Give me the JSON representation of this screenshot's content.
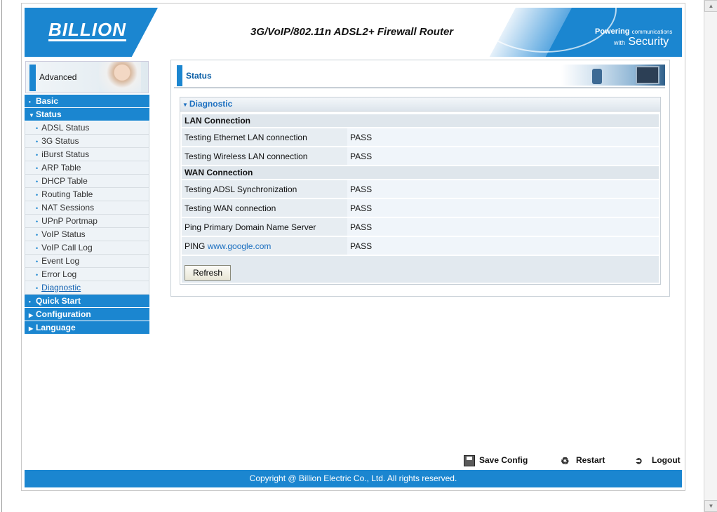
{
  "header": {
    "logo": "BILLION",
    "title": "3G/VoIP/802.11n ADSL2+ Firewall Router",
    "tagline_line1_bold": "Powering",
    "tagline_line1_small": "communications",
    "tagline_line2_small": "with",
    "tagline_line2_big": "Security"
  },
  "sidebar": {
    "mode_label": "Advanced",
    "sections": [
      {
        "label": "Basic",
        "expanded": false
      },
      {
        "label": "Status",
        "expanded": true
      }
    ],
    "status_items": [
      {
        "label": "ADSL Status"
      },
      {
        "label": "3G Status"
      },
      {
        "label": "iBurst Status"
      },
      {
        "label": "ARP Table"
      },
      {
        "label": "DHCP Table"
      },
      {
        "label": "Routing Table"
      },
      {
        "label": "NAT Sessions"
      },
      {
        "label": "UPnP Portmap"
      },
      {
        "label": "VoIP Status"
      },
      {
        "label": "VoIP Call Log"
      },
      {
        "label": "Event Log"
      },
      {
        "label": "Error Log"
      },
      {
        "label": "Diagnostic"
      }
    ],
    "bottom_sections": [
      {
        "label": "Quick Start"
      },
      {
        "label": "Configuration"
      },
      {
        "label": "Language"
      }
    ]
  },
  "main": {
    "title": "Status",
    "diagnostic": {
      "heading": "Diagnostic",
      "lan_section": "LAN Connection",
      "lan_rows": [
        {
          "label": "Testing Ethernet LAN connection",
          "result": "PASS"
        },
        {
          "label": "Testing Wireless LAN connection",
          "result": "PASS"
        }
      ],
      "wan_section": "WAN Connection",
      "wan_rows": [
        {
          "label": "Testing ADSL Synchronization",
          "result": "PASS"
        },
        {
          "label": "Testing WAN connection",
          "result": "PASS"
        },
        {
          "label": "Ping Primary Domain Name Server",
          "result": "PASS"
        }
      ],
      "ping_prefix": "PING",
      "ping_link": "www.google.com",
      "ping_result": "PASS",
      "refresh_label": "Refresh"
    }
  },
  "actions": {
    "save": "Save Config",
    "restart": "Restart",
    "logout": "Logout"
  },
  "footer": {
    "copyright": "Copyright @ Billion Electric Co., Ltd. All rights reserved."
  },
  "colors": {
    "brand_blue": "#1b86d0",
    "link_blue": "#1b6fc0"
  }
}
